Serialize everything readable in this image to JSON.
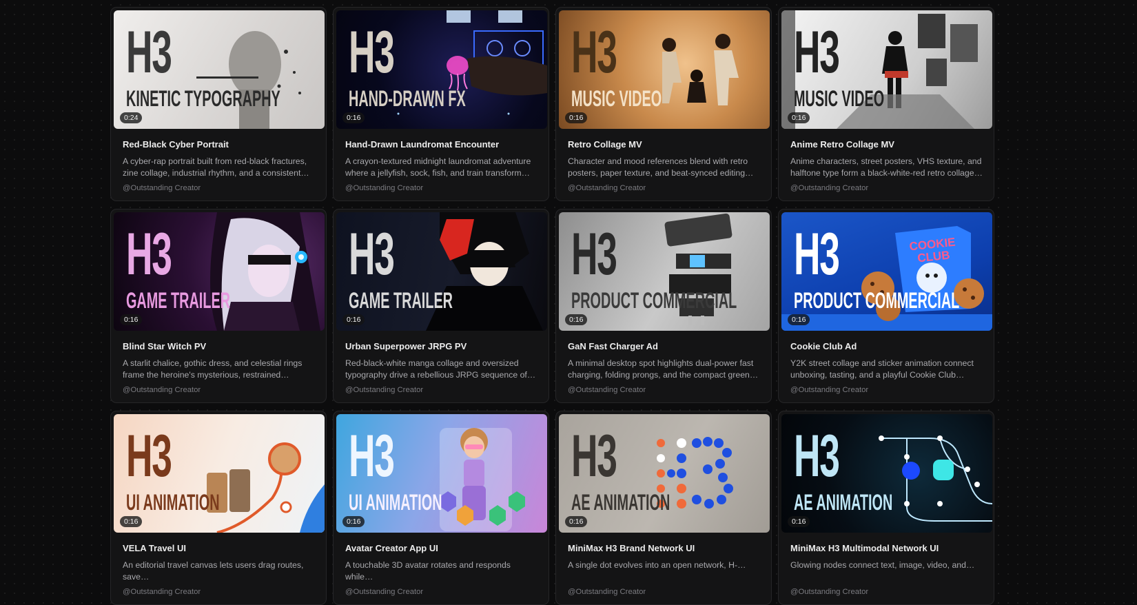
{
  "cards": [
    {
      "brand": "H3",
      "genre": "KINETIC TYPOGRAPHY",
      "duration": "0:24",
      "title": "Red-Black Cyber Portrait",
      "description": "A cyber-rap portrait built from red-black fractures, zine collage, industrial rhythm, and a consistent…",
      "creator": "@Outstanding Creator",
      "brand_color": "#3a3a3a",
      "genre_color": "#2a2a2a"
    },
    {
      "brand": "H3",
      "genre": "HAND-DRAWN FX",
      "duration": "0:16",
      "title": "Hand-Drawn Laundromat Encounter",
      "description": "A crayon-textured midnight laundromat adventure where a jellyfish, sock, fish, and train transform in…",
      "creator": "@Outstanding Creator",
      "brand_color": "#d6cfc4",
      "genre_color": "#d6cfc4"
    },
    {
      "brand": "H3",
      "genre": "MUSIC VIDEO",
      "duration": "0:16",
      "title": "Retro Collage MV",
      "description": "Character and mood references blend with retro posters, paper texture, and beat-synced editing for…",
      "creator": "@Outstanding Creator",
      "brand_color": "#4a3218",
      "genre_color": "#f4e2c8"
    },
    {
      "brand": "H3",
      "genre": "MUSIC VIDEO",
      "duration": "0:16",
      "title": "Anime Retro Collage MV",
      "description": "Anime characters, street posters, VHS texture, and halftone type form a black-white-red retro collage…",
      "creator": "@Outstanding Creator",
      "brand_color": "#222222",
      "genre_color": "#222222"
    },
    {
      "brand": "H3",
      "genre": "GAME TRAILER",
      "duration": "0:16",
      "title": "Blind Star Witch PV",
      "description": "A starlit chalice, gothic dress, and celestial rings frame the heroine's mysterious, restrained…",
      "creator": "@Outstanding Creator",
      "brand_color": "#e8a8e4",
      "genre_color": "#e89ae0"
    },
    {
      "brand": "H3",
      "genre": "GAME TRAILER",
      "duration": "0:16",
      "title": "Urban Superpower JRPG PV",
      "description": "Red-black-white manga collage and oversized typography drive a rebellious JRPG sequence of…",
      "creator": "@Outstanding Creator",
      "brand_color": "#d9d9d9",
      "genre_color": "#d9d9d9"
    },
    {
      "brand": "H3",
      "genre": "PRODUCT COMMERCIAL",
      "duration": "0:16",
      "title": "GaN Fast Charger Ad",
      "description": "A minimal desktop spot highlights dual-power fast charging, folding prongs, and the compact green…",
      "creator": "@Outstanding Creator",
      "brand_color": "#2a2a2a",
      "genre_color": "#3a3a3a"
    },
    {
      "brand": "H3",
      "genre": "PRODUCT COMMERCIAL",
      "duration": "0:16",
      "title": "Cookie Club Ad",
      "description": "Y2K street collage and sticker animation connect unboxing, tasting, and a playful Cookie Club…",
      "creator": "@Outstanding Creator",
      "brand_color": "#ffffff",
      "genre_color": "#ffffff"
    },
    {
      "brand": "H3",
      "genre": "UI ANIMATION",
      "duration": "0:16",
      "title": "VELA Travel UI",
      "description": "An editorial travel canvas lets users drag routes, save…",
      "creator": "@Outstanding Creator",
      "brand_color": "#7a3a1c",
      "genre_color": "#7a3a1c"
    },
    {
      "brand": "H3",
      "genre": "UI ANIMATION",
      "duration": "0:16",
      "title": "Avatar Creator App UI",
      "description": "A touchable 3D avatar rotates and responds while…",
      "creator": "@Outstanding Creator",
      "brand_color": "#eef6ff",
      "genre_color": "#f5f0ff"
    },
    {
      "brand": "H3",
      "genre": "AE ANIMATION",
      "duration": "0:16",
      "title": "MiniMax H3 Brand Network UI",
      "description": "A single dot evolves into an open network, H-…",
      "creator": "@Outstanding Creator",
      "brand_color": "#3a3632",
      "genre_color": "#3a3632"
    },
    {
      "brand": "H3",
      "genre": "AE ANIMATION",
      "duration": "0:16",
      "title": "MiniMax H3 Multimodal Network UI",
      "description": "Glowing nodes connect text, image, video, and…",
      "creator": "@Outstanding Creator",
      "brand_color": "#bfe6f6",
      "genre_color": "#bfe6f6"
    }
  ]
}
